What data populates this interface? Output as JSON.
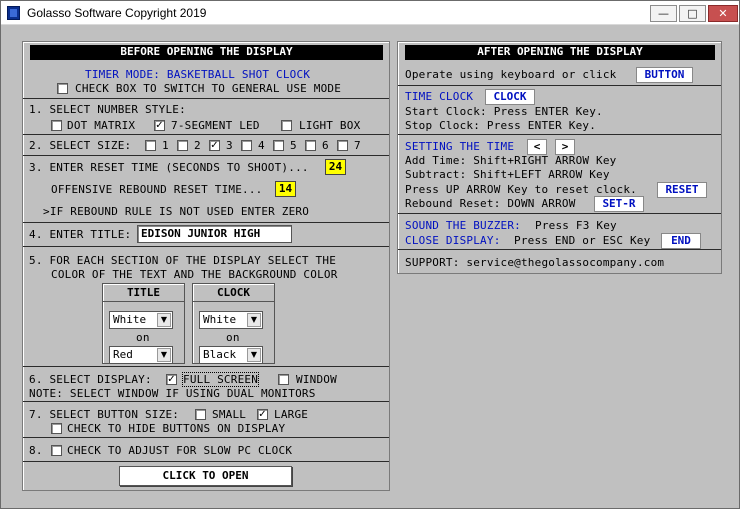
{
  "window": {
    "title": "Golasso Software Copyright 2019",
    "minimize_icon": "minimize-icon",
    "maximize_icon": "maximize-icon",
    "close_icon": "close-icon"
  },
  "left": {
    "header": "BEFORE OPENING THE DISPLAY",
    "timer_mode": "TIMER MODE: BASKETBALL SHOT CLOCK",
    "general_use": {
      "label": "CHECK BOX TO SWITCH TO GENERAL USE MODE",
      "checked": false
    },
    "number_style": {
      "label": "1. SELECT NUMBER STYLE:",
      "options": [
        {
          "label": "DOT MATRIX",
          "checked": false
        },
        {
          "label": "7-SEGMENT LED",
          "checked": true
        },
        {
          "label": "LIGHT BOX",
          "checked": false
        }
      ]
    },
    "size": {
      "label": "2. SELECT SIZE:",
      "options": [
        {
          "label": "1",
          "checked": false
        },
        {
          "label": "2",
          "checked": false
        },
        {
          "label": "3",
          "checked": true
        },
        {
          "label": "4",
          "checked": false
        },
        {
          "label": "5",
          "checked": false
        },
        {
          "label": "6",
          "checked": false
        },
        {
          "label": "7",
          "checked": false
        }
      ]
    },
    "reset_time": {
      "label": "3. ENTER RESET TIME (SECONDS TO SHOOT)...",
      "value": "24"
    },
    "rebound_reset": {
      "label": "OFFENSIVE REBOUND RESET TIME...",
      "value": "14"
    },
    "rebound_note": ">IF REBOUND RULE IS NOT USED ENTER ZERO",
    "title_field": {
      "label": "4. ENTER TITLE:",
      "value": "EDISON JUNIOR HIGH"
    },
    "colors": {
      "line1": "5. FOR EACH SECTION OF THE DISPLAY SELECT THE",
      "line2": "COLOR OF THE TEXT AND THE BACKGROUND COLOR",
      "on": "on",
      "title_box": {
        "header": "TITLE",
        "text_color": "White",
        "bg_color": "Red"
      },
      "clock_box": {
        "header": "CLOCK",
        "text_color": "White",
        "bg_color": "Black"
      }
    },
    "display": {
      "label": "6. SELECT DISPLAY:",
      "full_screen": {
        "label": "FULL SCREEN",
        "checked": true
      },
      "window": {
        "label": "WINDOW",
        "checked": false
      },
      "note": "NOTE: SELECT WINDOW IF USING DUAL MONITORS"
    },
    "button_size": {
      "label": "7. SELECT BUTTON SIZE:",
      "small": {
        "label": "SMALL",
        "checked": false
      },
      "large": {
        "label": "LARGE",
        "checked": true
      },
      "hide": {
        "label": "CHECK TO HIDE BUTTONS ON DISPLAY",
        "checked": false
      }
    },
    "slow_pc": {
      "label": "8.",
      "check_label": "CHECK TO ADJUST FOR SLOW PC CLOCK",
      "checked": false
    },
    "open_button": "CLICK TO OPEN"
  },
  "right": {
    "header": "AFTER OPENING THE DISPLAY",
    "operate": {
      "text": "Operate using keyboard or click",
      "button": "BUTTON"
    },
    "time_clock": {
      "label": "TIME CLOCK",
      "button": "CLOCK",
      "start": "Start Clock: Press ENTER Key.",
      "stop": "Stop Clock: Press ENTER Key."
    },
    "setting_time": {
      "label": "SETTING THE TIME",
      "left_btn": "<",
      "right_btn": ">",
      "add": "Add Time: Shift+RIGHT ARROW Key",
      "subtract": "Subtract: Shift+LEFT ARROW Key",
      "reset": "Press UP ARROW Key to reset clock.",
      "reset_btn": "RESET",
      "rebound": "Rebound Reset: DOWN ARROW",
      "rebound_btn": "SET-R"
    },
    "buzzer": {
      "label": "SOUND THE BUZZER:",
      "text": "Press F3 Key"
    },
    "close": {
      "label": "CLOSE DISPLAY:",
      "text": "Press END or ESC Key",
      "button": "END"
    },
    "support": "SUPPORT: service@thegolassocompany.com"
  },
  "colors": {
    "accent_blue": "#0010c0",
    "highlight_yellow": "#ffff00",
    "panel_gray": "#c0c0c0"
  }
}
